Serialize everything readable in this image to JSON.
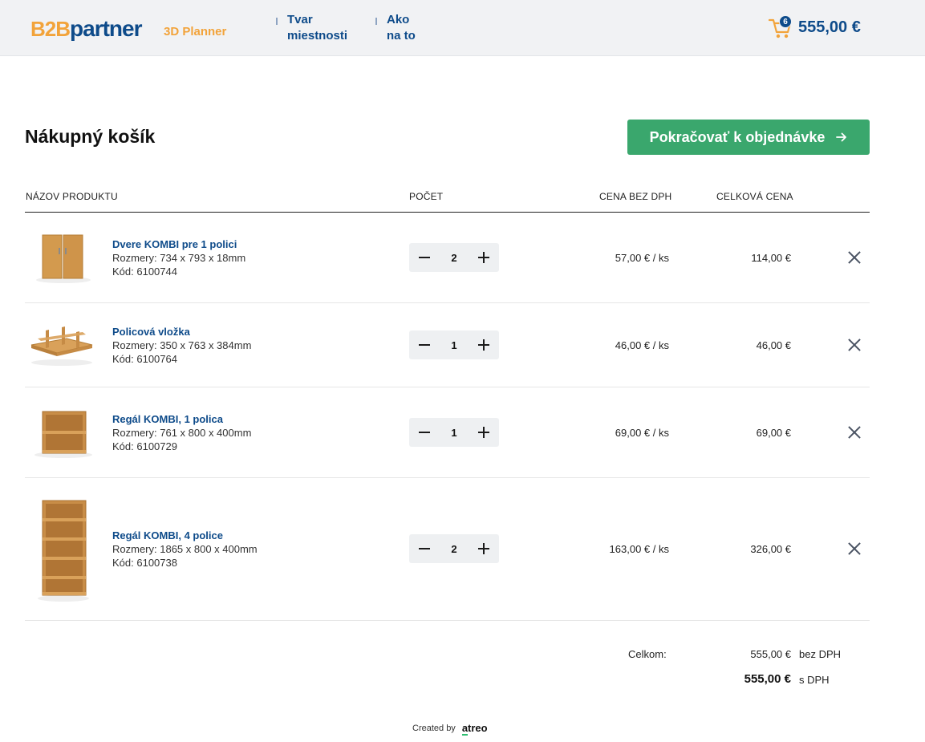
{
  "header": {
    "logo_b2b": "B2B",
    "logo_partner": "partner",
    "logo_product": "3D Planner",
    "nav": [
      {
        "line1": "Tvar",
        "line2": "miestnosti"
      },
      {
        "line1": "Ako",
        "line2": "na to"
      }
    ],
    "cart_count": "6",
    "cart_total": "555,00 €",
    "cart_icon": "shopping-cart-icon"
  },
  "page": {
    "title": "Nákupný košík",
    "continue_label": "Pokračovať k objednávke"
  },
  "table": {
    "columns": [
      "NÁZOV PRODUKTU",
      "POČET",
      "CENA BEZ DPH",
      "CELKOVÁ CENA"
    ],
    "rows": [
      {
        "name": "Dvere KOMBI pre 1 polici",
        "dimensions": "Rozmery: 734 x 793 x 18mm",
        "code": "Kód: 6100744",
        "qty": "2",
        "unit_price": "57,00 € / ks",
        "total": "114,00 €",
        "image": "door-panels"
      },
      {
        "name": "Policová vložka",
        "dimensions": "Rozmery: 350 x 763 x 384mm",
        "code": "Kód: 6100764",
        "qty": "1",
        "unit_price": "46,00 € / ks",
        "total": "46,00 €",
        "image": "shelf-insert"
      },
      {
        "name": "Regál KOMBI, 1 polica",
        "dimensions": "Rozmery: 761 x 800 x 400mm",
        "code": "Kód: 6100729",
        "qty": "1",
        "unit_price": "69,00 € / ks",
        "total": "69,00 €",
        "image": "low-shelf"
      },
      {
        "name": "Regál KOMBI, 4 police",
        "dimensions": "Rozmery: 1865 x 800 x 400mm",
        "code": "Kód: 6100738",
        "qty": "2",
        "unit_price": "163,00 € / ks",
        "total": "326,00 €",
        "image": "tall-shelf"
      }
    ]
  },
  "summary": {
    "label": "Celkom:",
    "net": "555,00 €",
    "net_suffix": "bez DPH",
    "gross": "555,00 €",
    "gross_suffix": "s DPH"
  },
  "footer": {
    "label": "Created by",
    "brand": "atreo"
  },
  "colors": {
    "brand_blue": "#0e4b8a",
    "brand_orange": "#f2a33a",
    "accent_green": "#3aa76d"
  }
}
